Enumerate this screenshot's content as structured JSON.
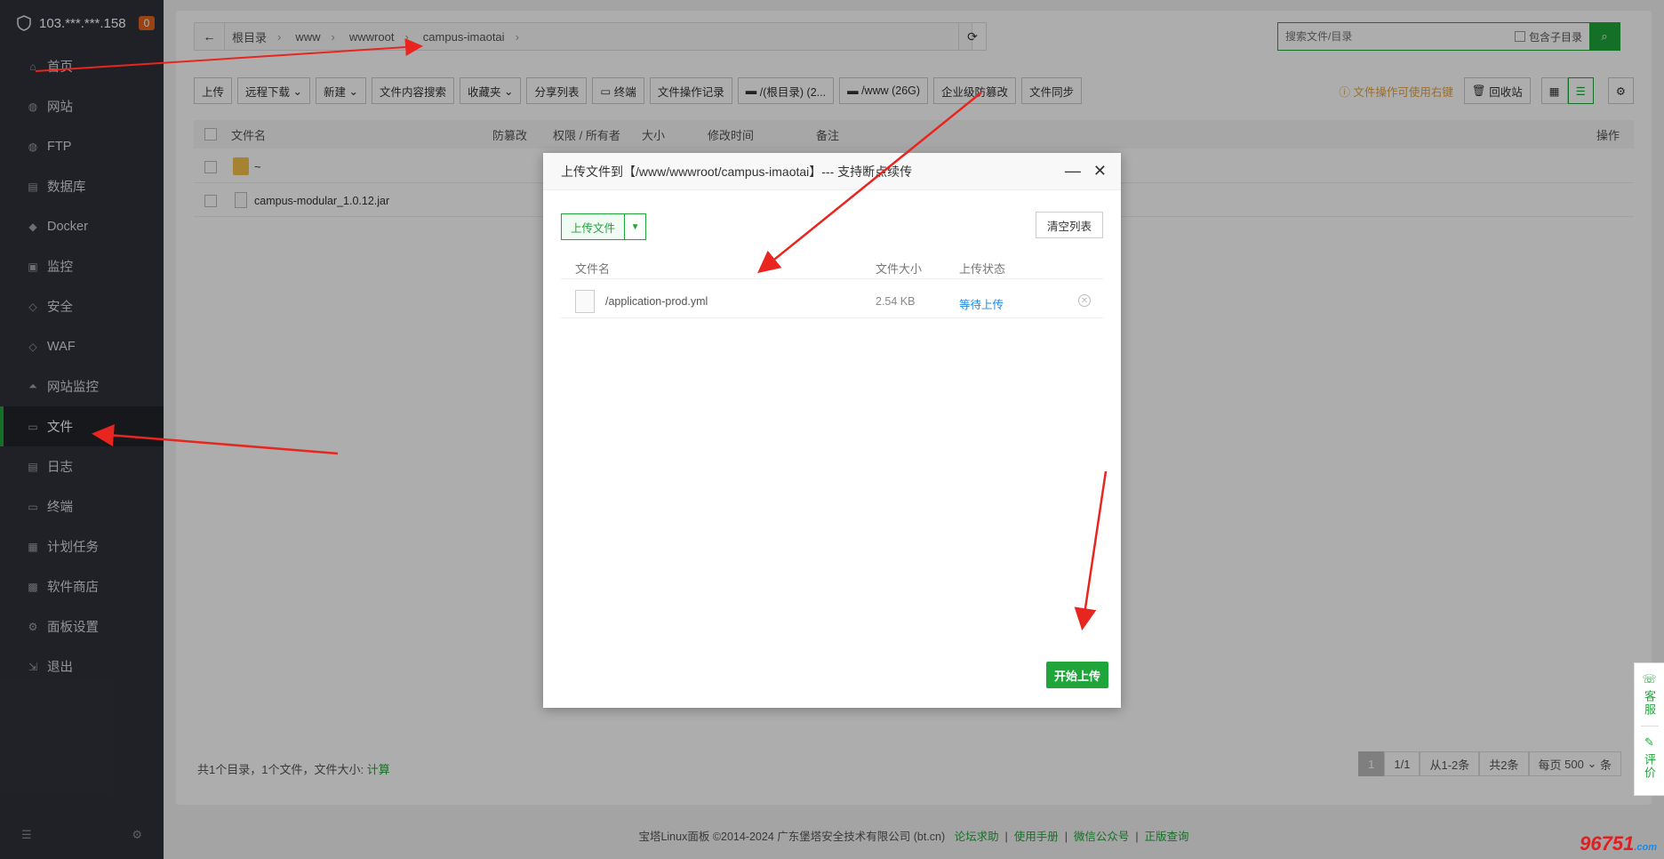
{
  "sidebar": {
    "server": "103.***.***.158",
    "badge": "0",
    "items": [
      {
        "label": "首页",
        "icon": "home-icon"
      },
      {
        "label": "网站",
        "icon": "globe-icon"
      },
      {
        "label": "FTP",
        "icon": "globe-icon"
      },
      {
        "label": "数据库",
        "icon": "database-icon"
      },
      {
        "label": "Docker",
        "icon": "docker-icon"
      },
      {
        "label": "监控",
        "icon": "monitor-icon"
      },
      {
        "label": "安全",
        "icon": "shield-icon"
      },
      {
        "label": "WAF",
        "icon": "shield-icon"
      },
      {
        "label": "网站监控",
        "icon": "chart-icon"
      },
      {
        "label": "文件",
        "icon": "folder-icon"
      },
      {
        "label": "日志",
        "icon": "log-icon"
      },
      {
        "label": "终端",
        "icon": "terminal-icon"
      },
      {
        "label": "计划任务",
        "icon": "calendar-icon"
      },
      {
        "label": "软件商店",
        "icon": "grid-icon"
      },
      {
        "label": "面板设置",
        "icon": "gear-icon"
      },
      {
        "label": "退出",
        "icon": "logout-icon"
      }
    ],
    "active_index": 9
  },
  "path": {
    "crumbs": [
      "根目录",
      "www",
      "wwwroot",
      "campus-imaotai"
    ]
  },
  "search": {
    "placeholder": "搜索文件/目录",
    "include_sub": "包含子目录"
  },
  "toolbar": {
    "upload": "上传",
    "remote_download": "远程下载",
    "new": "新建",
    "content_search": "文件内容搜索",
    "favorites": "收藏夹",
    "share_list": "分享列表",
    "terminal": "终端",
    "op_log": "文件操作记录",
    "disk_root": "/(根目录) (2...",
    "disk_www": "/www (26G)",
    "tamper": "企业级防篡改",
    "sync": "文件同步",
    "tip": "文件操作可使用右键",
    "recycle": "回收站"
  },
  "table": {
    "headers": [
      "文件名",
      "防篡改",
      "权限 / 所有者",
      "大小",
      "修改时间",
      "备注",
      "操作"
    ],
    "rows": [
      {
        "name": "~"
      },
      {
        "name": "campus-modular_1.0.12.jar"
      }
    ]
  },
  "footer": {
    "summary": "共1个目录，1个文件，文件大小:",
    "calc": "计算",
    "page_current": "1",
    "page_total": "1/1",
    "range": "从1-2条",
    "total": "共2条",
    "per_page_label": "每页",
    "per_page": "500",
    "per_page_unit": "条"
  },
  "copyright": {
    "text": "宝塔Linux面板 ©2014-2024 广东堡塔安全技术有限公司 (bt.cn)",
    "links": [
      "论坛求助",
      "使用手册",
      "微信公众号",
      "正版查询"
    ]
  },
  "dialog": {
    "title": "上传文件到【/www/wwwroot/campus-imaotai】--- 支持断点续传",
    "upload_btn": "上传文件",
    "clear_btn": "清空列表",
    "headers": [
      "文件名",
      "文件大小",
      "上传状态"
    ],
    "files": [
      {
        "name": "/application-prod.yml",
        "size": "2.54 KB",
        "status": "等待上传"
      }
    ],
    "start_btn": "开始上传"
  },
  "float": {
    "service": "客服",
    "review": "评价"
  },
  "watermark": {
    "text": "96751",
    "suffix": ".com"
  },
  "colors": {
    "accent": "#20a53a",
    "sidebar": "#30323a",
    "arrow": "#e8251f"
  }
}
